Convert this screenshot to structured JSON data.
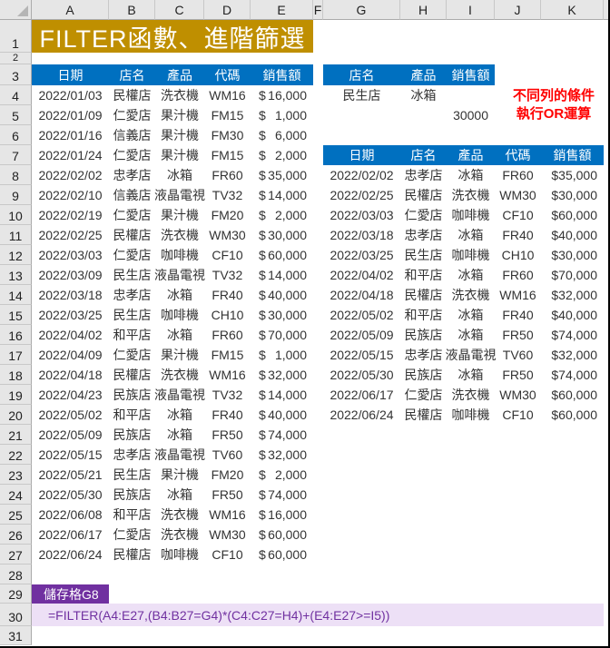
{
  "columns": [
    "A",
    "B",
    "C",
    "D",
    "E",
    "F",
    "G",
    "H",
    "I",
    "J",
    "K"
  ],
  "rows": [
    "1",
    "2",
    "3",
    "4",
    "5",
    "6",
    "7",
    "8",
    "9",
    "10",
    "11",
    "12",
    "13",
    "14",
    "15",
    "16",
    "17",
    "18",
    "19",
    "20",
    "21",
    "22",
    "23",
    "24",
    "25",
    "26",
    "27",
    "28",
    "29",
    "30",
    "31"
  ],
  "title": "FILTER函數、進階篩選",
  "source_table": {
    "headers": [
      "日期",
      "店名",
      "產品",
      "代碼",
      "銷售額"
    ],
    "rows": [
      [
        "2022/01/03",
        "民權店",
        "洗衣機",
        "WM16",
        "16,000"
      ],
      [
        "2022/01/09",
        "仁愛店",
        "果汁機",
        "FM15",
        "1,000"
      ],
      [
        "2022/01/16",
        "信義店",
        "果汁機",
        "FM30",
        "6,000"
      ],
      [
        "2022/01/24",
        "仁愛店",
        "果汁機",
        "FM15",
        "2,000"
      ],
      [
        "2022/02/02",
        "忠孝店",
        "冰箱",
        "FR60",
        "35,000"
      ],
      [
        "2022/02/10",
        "信義店",
        "液晶電視",
        "TV32",
        "14,000"
      ],
      [
        "2022/02/19",
        "仁愛店",
        "果汁機",
        "FM20",
        "2,000"
      ],
      [
        "2022/02/25",
        "民權店",
        "洗衣機",
        "WM30",
        "30,000"
      ],
      [
        "2022/03/03",
        "仁愛店",
        "咖啡機",
        "CF10",
        "60,000"
      ],
      [
        "2022/03/09",
        "民生店",
        "液晶電視",
        "TV32",
        "14,000"
      ],
      [
        "2022/03/18",
        "忠孝店",
        "冰箱",
        "FR40",
        "40,000"
      ],
      [
        "2022/03/25",
        "民生店",
        "咖啡機",
        "CH10",
        "30,000"
      ],
      [
        "2022/04/02",
        "和平店",
        "冰箱",
        "FR60",
        "70,000"
      ],
      [
        "2022/04/09",
        "仁愛店",
        "果汁機",
        "FM15",
        "1,000"
      ],
      [
        "2022/04/18",
        "民權店",
        "洗衣機",
        "WM16",
        "32,000"
      ],
      [
        "2022/04/23",
        "民族店",
        "液晶電視",
        "TV32",
        "14,000"
      ],
      [
        "2022/05/02",
        "和平店",
        "冰箱",
        "FR40",
        "40,000"
      ],
      [
        "2022/05/09",
        "民族店",
        "冰箱",
        "FR50",
        "74,000"
      ],
      [
        "2022/05/15",
        "忠孝店",
        "液晶電視",
        "TV60",
        "32,000"
      ],
      [
        "2022/05/21",
        "民生店",
        "果汁機",
        "FM20",
        "2,000"
      ],
      [
        "2022/05/30",
        "民族店",
        "冰箱",
        "FR50",
        "74,000"
      ],
      [
        "2022/06/08",
        "和平店",
        "洗衣機",
        "WM16",
        "16,000"
      ],
      [
        "2022/06/17",
        "仁愛店",
        "洗衣機",
        "WM30",
        "60,000"
      ],
      [
        "2022/06/24",
        "民權店",
        "咖啡機",
        "CF10",
        "60,000"
      ]
    ],
    "currency_symbol": "$"
  },
  "criteria": {
    "headers": [
      "店名",
      "產品",
      "銷售額"
    ],
    "row1": [
      "民生店",
      "冰箱",
      ""
    ],
    "row2": [
      "",
      "",
      "30000"
    ]
  },
  "note": {
    "line1": "不同列的條件",
    "line2": "執行OR運算"
  },
  "result_table": {
    "headers": [
      "日期",
      "店名",
      "產品",
      "代碼",
      "銷售額"
    ],
    "rows": [
      [
        "2022/02/02",
        "忠孝店",
        "冰箱",
        "FR60",
        "$35,000"
      ],
      [
        "2022/02/25",
        "民權店",
        "洗衣機",
        "WM30",
        "$30,000"
      ],
      [
        "2022/03/03",
        "仁愛店",
        "咖啡機",
        "CF10",
        "$60,000"
      ],
      [
        "2022/03/18",
        "忠孝店",
        "冰箱",
        "FR40",
        "$40,000"
      ],
      [
        "2022/03/25",
        "民生店",
        "咖啡機",
        "CH10",
        "$30,000"
      ],
      [
        "2022/04/02",
        "和平店",
        "冰箱",
        "FR60",
        "$70,000"
      ],
      [
        "2022/04/18",
        "民權店",
        "洗衣機",
        "WM16",
        "$32,000"
      ],
      [
        "2022/05/02",
        "和平店",
        "冰箱",
        "FR40",
        "$40,000"
      ],
      [
        "2022/05/09",
        "民族店",
        "冰箱",
        "FR50",
        "$74,000"
      ],
      [
        "2022/05/15",
        "忠孝店",
        "液晶電視",
        "TV60",
        "$32,000"
      ],
      [
        "2022/05/30",
        "民族店",
        "冰箱",
        "FR50",
        "$74,000"
      ],
      [
        "2022/06/17",
        "仁愛店",
        "洗衣機",
        "WM30",
        "$60,000"
      ],
      [
        "2022/06/24",
        "民權店",
        "咖啡機",
        "CF10",
        "$60,000"
      ]
    ]
  },
  "formula_label": "儲存格G8",
  "formula": "=FILTER(A4:E27,(B4:B27=G4)*(C4:C27=H4)+(E4:E27>=I5))",
  "colors": {
    "title_bg": "#bf8f00",
    "header_bg": "#0070c0",
    "note_text": "#ff0000",
    "cellref_bg": "#7030a0",
    "formula_bg": "#ede0f6",
    "formula_text": "#7030a0"
  }
}
